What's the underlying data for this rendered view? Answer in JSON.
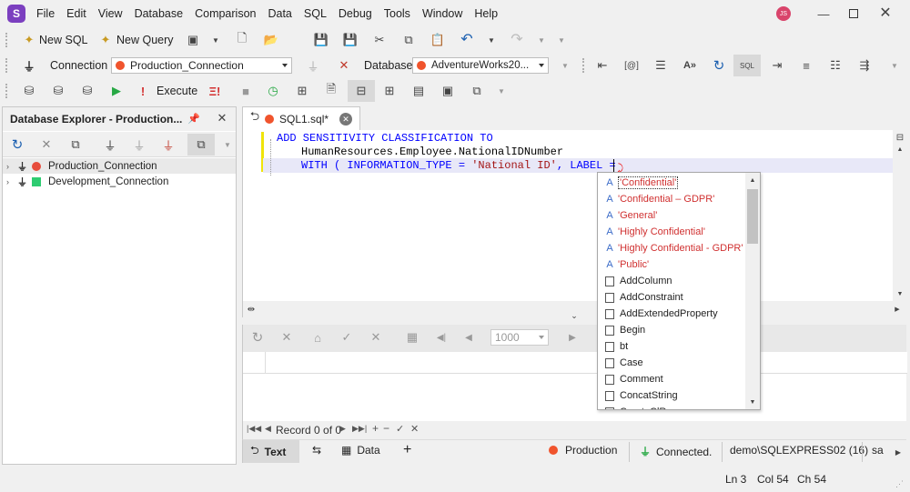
{
  "app": {
    "logo": "S",
    "user_initials": "JS",
    "colors": {
      "accent": "#7b3fbf",
      "red": "#e74c3c",
      "green": "#2ecc71",
      "pink": "#d9446b"
    }
  },
  "menu": [
    "File",
    "Edit",
    "View",
    "Database",
    "Comparison",
    "Data",
    "SQL",
    "Debug",
    "Tools",
    "Window",
    "Help"
  ],
  "toolbar1": {
    "new_sql": "New SQL",
    "new_query": "New Query"
  },
  "toolbar2": {
    "connection_label": "Connection",
    "connection_value": "Production_Connection",
    "database_label": "Database",
    "database_value": "AdventureWorks20..."
  },
  "toolbar3": {
    "execute": "Execute"
  },
  "explorer": {
    "title": "Database Explorer - Production...",
    "items": [
      {
        "label": "Production_Connection",
        "color": "#e74c3c"
      },
      {
        "label": "Development_Connection",
        "color": "#2ecc71"
      }
    ]
  },
  "doc_tab": {
    "title": "SQL1.sql*"
  },
  "editor": {
    "line1": "ADD SENSITIVITY CLASSIFICATION TO",
    "line2": "HumanResources.Employee.NationalIDNumber",
    "line3_a": "WITH ( INFORMATION_TYPE = ",
    "line3_str": "'National ID'",
    "line3_b": ", LABEL = "
  },
  "autocomplete": {
    "items": [
      {
        "type": "string",
        "label": "'Confidential'"
      },
      {
        "type": "string",
        "label": "'Confidential – GDPR'"
      },
      {
        "type": "string",
        "label": "'General'"
      },
      {
        "type": "string",
        "label": "'Highly Confidential'"
      },
      {
        "type": "string",
        "label": "'Highly Confidential - GDPR'"
      },
      {
        "type": "string",
        "label": "'Public'"
      },
      {
        "type": "func",
        "label": "AddColumn"
      },
      {
        "type": "func",
        "label": "AddConstraint"
      },
      {
        "type": "func",
        "label": "AddExtendedProperty"
      },
      {
        "type": "func",
        "label": "Begin"
      },
      {
        "type": "func",
        "label": "bt"
      },
      {
        "type": "func",
        "label": "Case"
      },
      {
        "type": "func",
        "label": "Comment"
      },
      {
        "type": "func",
        "label": "ConcatString"
      },
      {
        "type": "func",
        "label": "CreateClRows..."
      }
    ]
  },
  "results": {
    "rows_count": "1000",
    "record": "Record 0 of 0"
  },
  "bottom_tabs": {
    "text": "Text",
    "data": "Data"
  },
  "status": {
    "connection": "Production",
    "connected": "Connected.",
    "server": "demo\\SQLEXPRESS02 (16)",
    "user": "sa",
    "ln": "Ln 3",
    "col": "Col 54",
    "ch": "Ch 54"
  }
}
